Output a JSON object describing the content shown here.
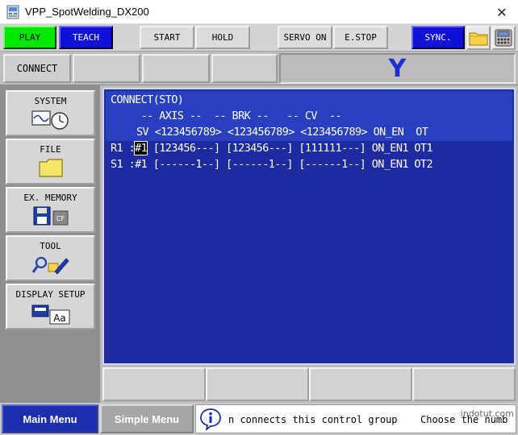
{
  "window": {
    "title": "VPP_SpotWelding_DX200",
    "close_glyph": "✕"
  },
  "toolbar": {
    "play": "PLAY",
    "teach": "TEACH",
    "start": "START",
    "hold": "HOLD",
    "servo_on": "SERVO ON",
    "estop": "E.STOP",
    "sync": "SYNC.",
    "folder_icon": "folder-icon",
    "pendant_icon": "teach-pendant-icon"
  },
  "row2": {
    "connect": "CONNECT",
    "axis_label": "Y"
  },
  "menu": {
    "items": [
      {
        "label": "SYSTEM",
        "icon": "system-icon"
      },
      {
        "label": "FILE",
        "icon": "file-folder-icon"
      },
      {
        "label": "EX. MEMORY",
        "icon": "ex-memory-icon"
      },
      {
        "label": "TOOL",
        "icon": "tool-icon"
      },
      {
        "label": "DISPLAY SETUP",
        "icon": "display-setup-icon"
      }
    ]
  },
  "content": {
    "title": "CONNECT(STO)",
    "group_header": "     -- AXIS --  -- BRK --   -- CV  --",
    "column_header": "SV <123456789> <123456789> <123456789> ON_EN  OT",
    "rows": [
      {
        "prefix": "R1 :",
        "cursor": "#1",
        "rest": " [123456---] [123456---] [111111---] ON_EN1 OT1"
      },
      {
        "prefix": "S1 :",
        "cursor": "#1",
        "rest": " [------1--] [------1--] [------1--] ON_EN1 OT2"
      }
    ]
  },
  "status": {
    "main_menu": "Main Menu",
    "simple_menu": "Simple Menu",
    "message": "n connects this control group",
    "message2": "Choose the numb",
    "watermark": "indotut.com"
  }
}
